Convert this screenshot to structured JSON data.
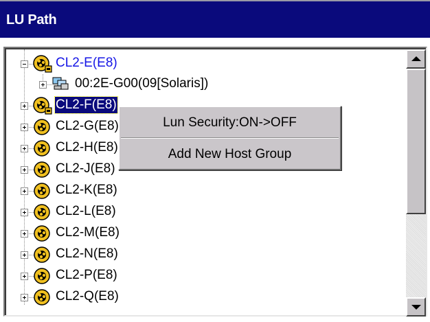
{
  "window": {
    "title": "LU Path"
  },
  "tree": {
    "ports": [
      {
        "label": "CL2-E(E8)",
        "expanded": true,
        "highlight": "blue"
      },
      {
        "label": "CL2-F(E8)",
        "expanded": false,
        "highlight": "selected"
      },
      {
        "label": "CL2-G(E8)",
        "expanded": false
      },
      {
        "label": "CL2-H(E8)",
        "expanded": false
      },
      {
        "label": "CL2-J(E8)",
        "expanded": false
      },
      {
        "label": "CL2-K(E8)",
        "expanded": false
      },
      {
        "label": "CL2-L(E8)",
        "expanded": false
      },
      {
        "label": "CL2-M(E8)",
        "expanded": false
      },
      {
        "label": "CL2-N(E8)",
        "expanded": false
      },
      {
        "label": "CL2-P(E8)",
        "expanded": false
      },
      {
        "label": "CL2-Q(E8)",
        "expanded": false
      }
    ],
    "host_group": {
      "label": "00:2E-G00(09[Solaris])"
    }
  },
  "context_menu": {
    "items": [
      {
        "label": "Lun Security:ON->OFF"
      },
      {
        "label": "Add New Host Group"
      }
    ]
  },
  "icons": {
    "port": "port-key-icon",
    "host_group": "host-group-icon",
    "expand": "plus-box-icon",
    "collapse": "minus-box-icon",
    "scroll_up": "scroll-up-arrow-icon",
    "scroll_down": "scroll-down-arrow-icon"
  },
  "colors": {
    "title_bar": "#0a0a7c",
    "selected_bg": "#0a0a7c",
    "active_link": "#1515e6",
    "menu_bg": "#cac6ca"
  }
}
